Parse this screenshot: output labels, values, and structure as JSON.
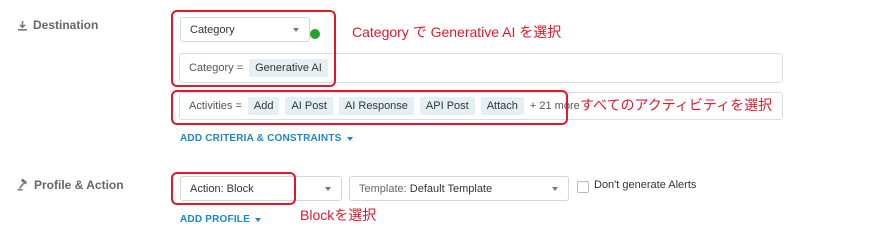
{
  "destination": {
    "section_label": "Destination",
    "category_select": "Category",
    "category_filter_key": "Category =",
    "category_filter_value": "Generative AI",
    "activities_key": "Activities =",
    "activities": [
      "Add",
      "AI Post",
      "AI Response",
      "API Post",
      "Attach"
    ],
    "activities_more": "+ 21 more",
    "add_criteria_label": "ADD CRITERIA & CONSTRAINTS"
  },
  "profile_action": {
    "section_label": "Profile & Action",
    "action_select": "Action: Block",
    "template_prefix": "Template:",
    "template_value": "Default Template",
    "dont_generate_alerts": "Don't generate Alerts",
    "add_profile_label": "ADD PROFILE"
  },
  "annotations": {
    "category_note": "Category で Generative AI を選択",
    "activities_note": "すべてのアクティビティを選択",
    "block_note": "Blockを選択"
  },
  "colors": {
    "annotation_red": "#e0192b",
    "link_blue": "#1e88c6",
    "chip_bg": "#e5f0f5",
    "status_green": "#2ca02c"
  }
}
